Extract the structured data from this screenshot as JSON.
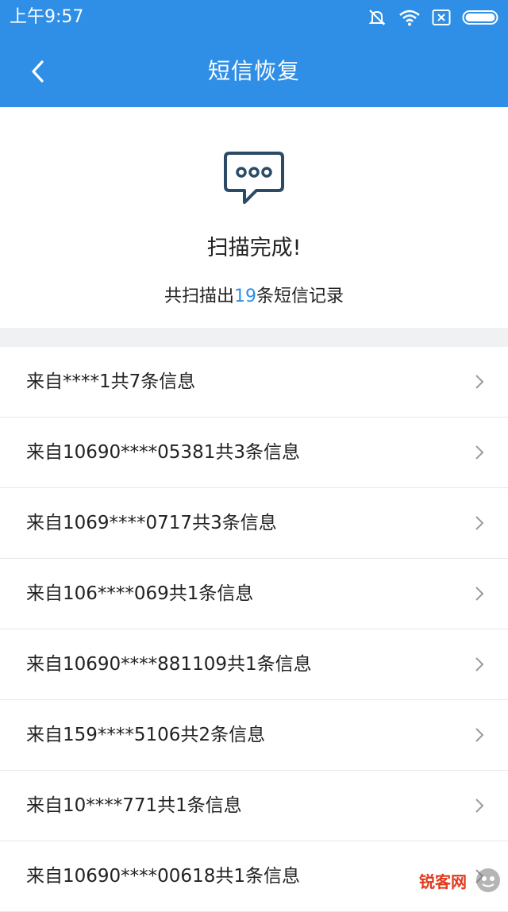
{
  "status_bar": {
    "time": "上午9:57"
  },
  "header": {
    "title": "短信恢复",
    "back_icon": "chevron-left-icon"
  },
  "summary": {
    "icon": "message-bubble-icon",
    "title": "扫描完成!",
    "desc_prefix": "共扫描出",
    "desc_count": "19",
    "desc_suffix": "条短信记录"
  },
  "list": [
    {
      "label": "来自****1共7条信息"
    },
    {
      "label": "来自10690****05381共3条信息"
    },
    {
      "label": "来自1069****0717共3条信息"
    },
    {
      "label": "来自106****069共1条信息"
    },
    {
      "label": "来自10690****881109共1条信息"
    },
    {
      "label": "来自159****5106共2条信息"
    },
    {
      "label": "来自10****771共1条信息"
    },
    {
      "label": "来自10690****00618共1条信息"
    }
  ],
  "watermark": {
    "text": "锐客网"
  },
  "colors": {
    "accent": "#2f8fe6",
    "watermark": "#e03b1e"
  }
}
